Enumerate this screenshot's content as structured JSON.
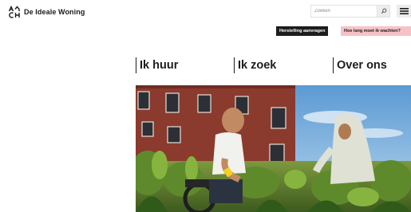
{
  "header": {
    "brand_name": "De Ideale Woning",
    "logo_icon": "house-logo-icon",
    "search": {
      "placeholder": "Zoeken",
      "icon": "search-icon"
    },
    "menu_icon": "hamburger-menu-icon"
  },
  "actions": {
    "repair_label": "Herstelling aanvragen",
    "wait_label": "Hoe lang moet ik wachten?"
  },
  "nav": [
    {
      "label": "Ik huur"
    },
    {
      "label": "Ik zoek"
    },
    {
      "label": "Over ons"
    }
  ],
  "hero": {
    "image_description_icon": "hero-image"
  },
  "colors": {
    "dark_button": "#1d1d1d",
    "pink_button": "#f6c2c6",
    "text": "#1a1a1a"
  }
}
